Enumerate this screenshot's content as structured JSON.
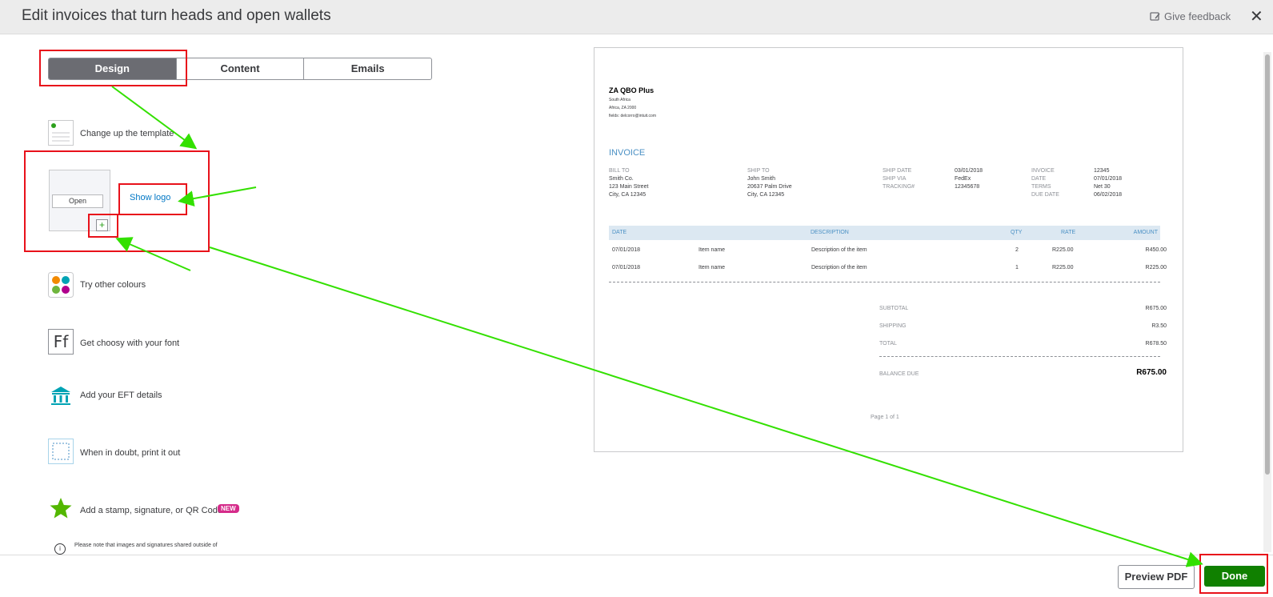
{
  "header": {
    "title": "Edit invoices that turn heads and open wallets",
    "feedback_label": "Give feedback",
    "close_glyph": "✕"
  },
  "tabs": [
    {
      "label": "Design",
      "active": true
    },
    {
      "label": "Content",
      "active": false
    },
    {
      "label": "Emails",
      "active": false
    }
  ],
  "options": {
    "template_label": "Change up the template",
    "logo_open_label": "Open",
    "logo_plus": "+",
    "show_logo_label": "Show logo",
    "colours_label": "Try other colours",
    "font_label": "Get choosy with your font",
    "font_icon_text": "Ff",
    "eft_label": "Add your EFT details",
    "print_label": "When in doubt, print it out",
    "stamp_label": "Add a stamp, signature, or QR Code",
    "stamp_badge": "NEW",
    "note_text": "Please note that images and signatures shared outside of"
  },
  "invoice": {
    "company": "ZA QBO Plus",
    "address_lines": [
      "South Africa",
      "Africa, ZA 2000",
      "fields: delcorro@intuit.com"
    ],
    "heading": "INVOICE",
    "bill_to_label": "BILL TO",
    "bill_to": [
      "Smith Co.",
      "123 Main Street",
      "City, CA 12345"
    ],
    "ship_to_label": "SHIP TO",
    "ship_to": [
      "John Smith",
      "20637 Palm Drive",
      "City, CA 12345"
    ],
    "ship_labels": [
      "SHIP DATE",
      "SHIP VIA",
      "TRACKING#"
    ],
    "ship_values": [
      "03/01/2018",
      "FedEx",
      "12345678"
    ],
    "inv_labels": [
      "INVOICE",
      "DATE",
      "TERMS",
      "DUE DATE"
    ],
    "inv_values": [
      "12345",
      "07/01/2018",
      "Net 30",
      "06/02/2018"
    ],
    "columns": [
      "DATE",
      "DESCRIPTION",
      "QTY",
      "RATE",
      "AMOUNT"
    ],
    "rows": [
      {
        "date": "07/01/2018",
        "item": "Item name",
        "desc": "Description of the item",
        "qty": "2",
        "rate": "R225.00",
        "amount": "R450.00"
      },
      {
        "date": "07/01/2018",
        "item": "Item name",
        "desc": "Description of the item",
        "qty": "1",
        "rate": "R225.00",
        "amount": "R225.00"
      }
    ],
    "subtotal_label": "SUBTOTAL",
    "subtotal": "R675.00",
    "shipping_label": "SHIPPING",
    "shipping": "R3.50",
    "total_label": "TOTAL",
    "total": "R678.50",
    "balance_label": "BALANCE DUE",
    "balance": "R675.00",
    "page_text": "Page 1 of 1"
  },
  "footer": {
    "preview_pdf_label": "Preview PDF",
    "done_label": "Done"
  },
  "colors": {
    "accent_green": "#108000",
    "annotation_red": "#e8111a",
    "annotation_arrow": "#33e000",
    "invoice_blue": "#4a90c4"
  }
}
